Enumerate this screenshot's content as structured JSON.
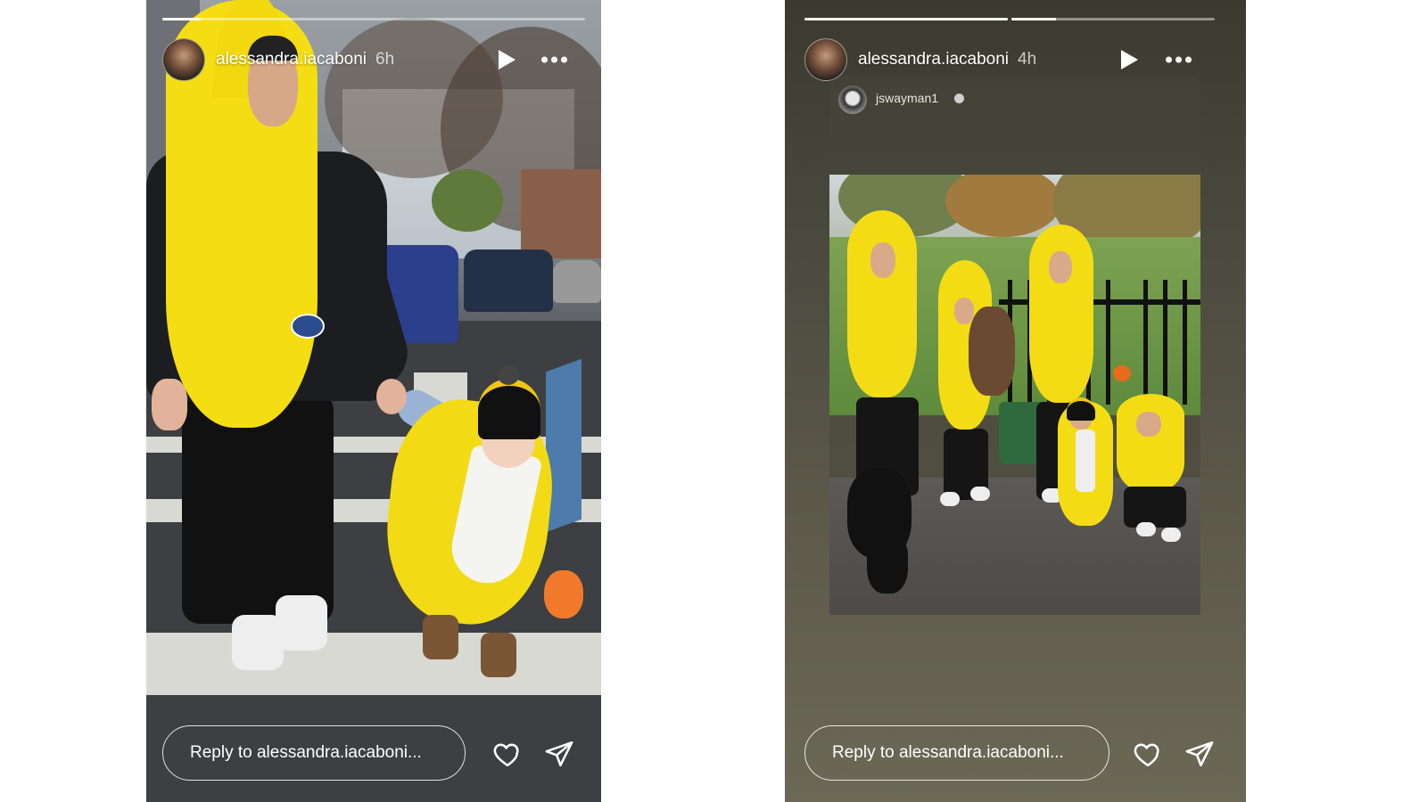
{
  "stories": [
    {
      "username": "alessandra.iacaboni",
      "time": "6h",
      "progress": {
        "segments": 1,
        "active_fill": 0.09
      },
      "reply_placeholder": "Reply to alessandra.iacaboni..."
    },
    {
      "username": "alessandra.iacaboni",
      "time": "4h",
      "progress": {
        "segments": 2,
        "active_fill": 0.22
      },
      "reshare": {
        "username": "jswayman1"
      },
      "reply_placeholder": "Reply to alessandra.iacaboni..."
    }
  ],
  "icons": {
    "play": "play-icon",
    "more": "more-options-icon",
    "like": "heart-icon",
    "share": "send-icon",
    "verified": "verified-badge-icon"
  },
  "colors": {
    "costume_yellow": "#f4dd12",
    "story2_background": "#4e4c40",
    "text": "#ffffff"
  }
}
